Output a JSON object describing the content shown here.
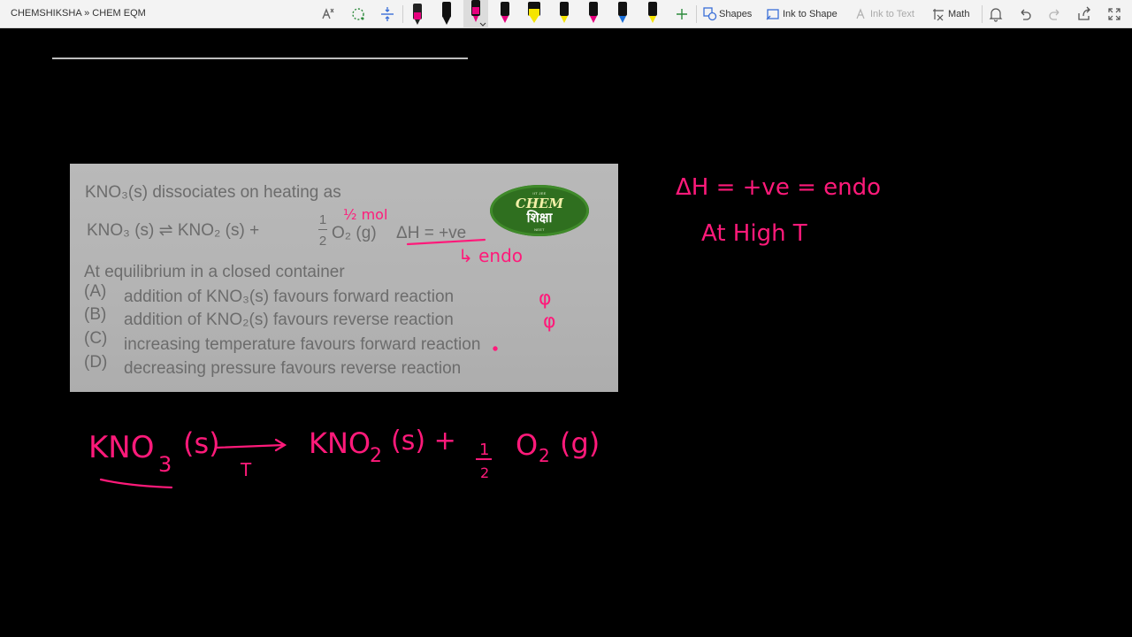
{
  "breadcrumb": "CHEMSHIKSHA » CHEM EQM",
  "toolbar": {
    "shapes_label": "Shapes",
    "ink_to_shape_label": "Ink to Shape",
    "ink_to_text_label": "Ink to Text",
    "math_label": "Math",
    "pen_colors": [
      "#e6007e",
      "#111111",
      "#e6007e",
      "#111111",
      "#f5e400",
      "#f5e400",
      "#e6007e",
      "#1b6fd8",
      "#f5e400"
    ]
  },
  "scan": {
    "intro": "KNO₃(s) dissociates on heating as",
    "equation_left": "KNO₃ (s) ⇌ KNO₂ (s) +",
    "frac_num": "1",
    "frac_den": "2",
    "equation_right": "O₂ (g)",
    "delta_h": "ΔH = +ve",
    "condition": "At equilibrium in a closed container",
    "options": [
      {
        "label": "(A)",
        "text": "addition of KNO₃(s) favours forward reaction"
      },
      {
        "label": "(B)",
        "text": "addition of KNO₂(s) favours reverse reaction"
      },
      {
        "label": "(C)",
        "text": "increasing temperature favours forward reaction"
      },
      {
        "label": "(D)",
        "text": "decreasing pressure favours reverse reaction"
      }
    ],
    "logo": {
      "top": "IIT JEE",
      "main": "CHEM",
      "sub": "शिक्षा",
      "bottom": "NEET"
    }
  },
  "ink": {
    "color": "#ff1a7a",
    "half_mol": "½ mol",
    "endo_arrow": "↳ endo",
    "mark_a": "φ",
    "mark_b": "φ",
    "side_line1": "ΔH = +ve = endo",
    "side_line2": "At High T",
    "eq_kno3": "KNO",
    "eq_sub3": "3",
    "eq_s": "(s)",
    "eq_t": "T",
    "eq_kno2": "KNO",
    "eq_sub2": "2",
    "eq_s2": "(s) +",
    "eq_half_num": "1",
    "eq_half_den": "2",
    "eq_o2": "O",
    "eq_o2_sub": "2",
    "eq_g": "(g)"
  }
}
